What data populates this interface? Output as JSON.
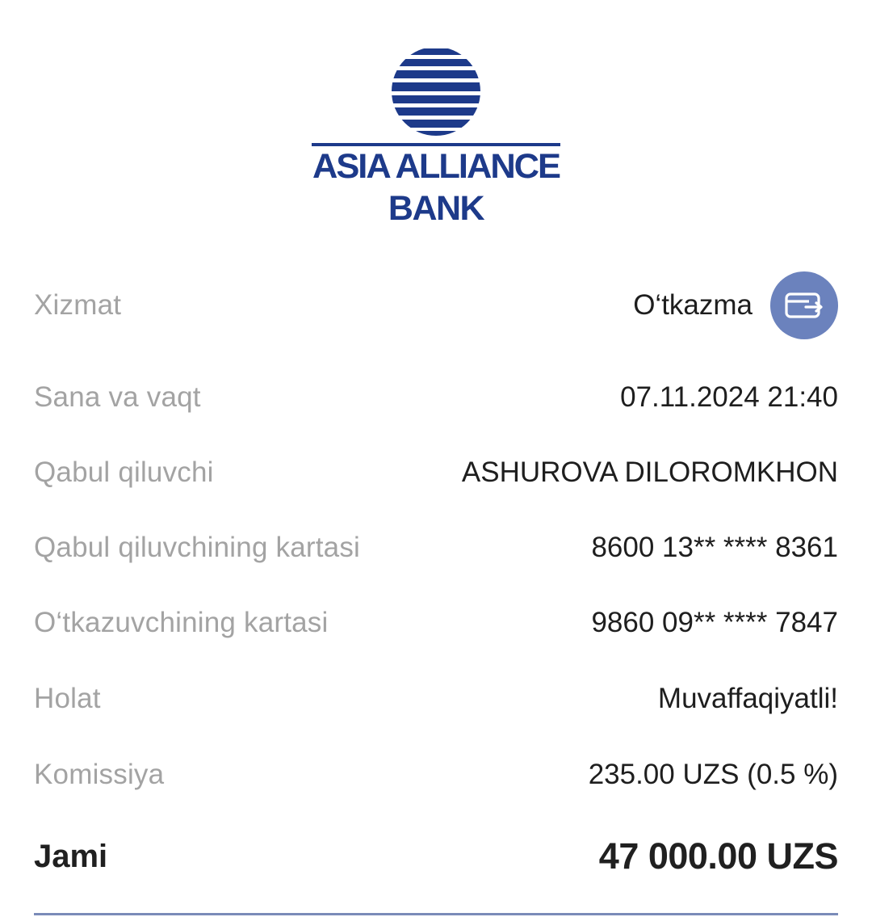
{
  "brand": {
    "name_line1": "ASIA ALLIANCE",
    "name_line2": "BANK",
    "color": "#1d3a8a"
  },
  "details": {
    "service": {
      "label": "Xizmat",
      "value": "O‘tkazma",
      "icon": "card-transfer-icon",
      "icon_bg": "#6b82bd"
    },
    "datetime": {
      "label": "Sana va vaqt",
      "value": "07.11.2024 21:40"
    },
    "recipient": {
      "label": "Qabul qiluvchi",
      "value": "ASHUROVA DILOROMKHON"
    },
    "recipient_card": {
      "label": "Qabul qiluvchining kartasi",
      "value": "8600 13** **** 8361"
    },
    "sender_card": {
      "label": "O‘tkazuvchining kartasi",
      "value": "9860 09** **** 7847"
    },
    "status": {
      "label": "Holat",
      "value": "Muvaffaqiyatli!"
    },
    "commission": {
      "label": "Komissiya",
      "value": "235.00 UZS (0.5 %)"
    }
  },
  "total": {
    "label": "Jami",
    "value": "47 000.00 UZS"
  }
}
